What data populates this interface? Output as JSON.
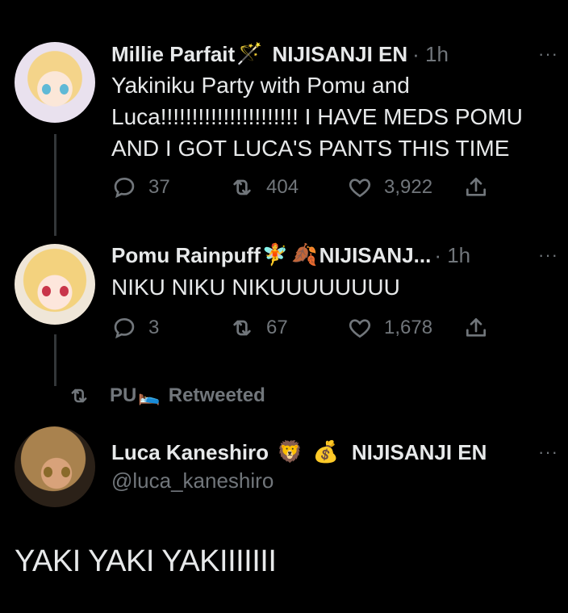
{
  "tweets": [
    {
      "display_name": "Millie Parfait",
      "name_emoji": "🪄",
      "affiliation": "NIJISANJI EN",
      "time": "· 1h",
      "text": "Yakiniku Party with Pomu and Luca!!!!!!!!!!!!!!!!!!!!!! I HAVE MEDS POMU AND I GOT LUCA'S PANTS THIS TIME",
      "replies": "37",
      "retweets": "404",
      "likes": "3,922"
    },
    {
      "display_name": "Pomu Rainpuff",
      "name_emoji": "🧚",
      "name_emoji2": "🍂",
      "affiliation": "NIJISANJ...",
      "time": "· 1h",
      "text": "NIKU NIKU NIKUUUUUUUU",
      "replies": "3",
      "retweets": "67",
      "likes": "1,678"
    }
  ],
  "retweet_banner": {
    "user": "PU",
    "user_emoji": "🛌",
    "label": "Retweeted"
  },
  "quoted": {
    "display_name": "Luca Kaneshiro",
    "name_emoji": "🦁",
    "name_emoji2": "💰",
    "affiliation": "NIJISANJI EN",
    "handle": "@luca_kaneshiro",
    "text": "YAKI YAKI YAKIIIIIII"
  },
  "more_glyph": "···",
  "icons": [
    "reply-icon",
    "retweet-icon",
    "like-icon",
    "share-icon",
    "more-icon"
  ],
  "colors": {
    "background": "#000000",
    "text": "#e7e9ea",
    "muted": "#71767b",
    "line": "#333639"
  }
}
